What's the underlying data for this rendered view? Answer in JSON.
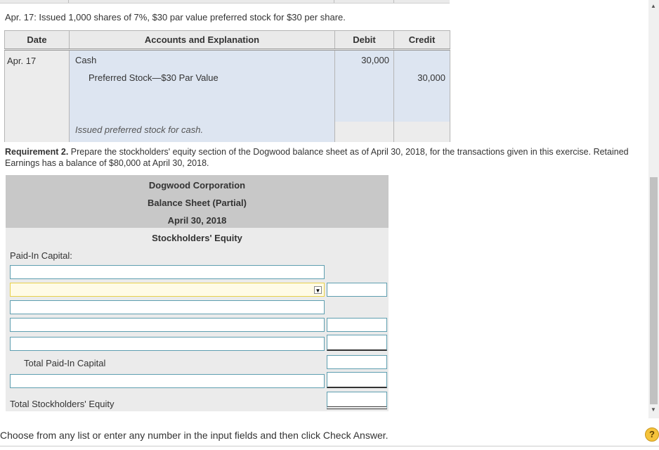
{
  "problem_text": "Apr. 17: Issued 1,000 shares of 7%, $30 par value preferred stock for $30 per share.",
  "journal": {
    "headers": {
      "date": "Date",
      "accounts": "Accounts and Explanation",
      "debit": "Debit",
      "credit": "Credit"
    },
    "date": "Apr. 17",
    "debit_account": "Cash",
    "debit_amount": "30,000",
    "credit_account": "Preferred Stock—$30 Par Value",
    "credit_amount": "30,000",
    "explanation": "Issued preferred stock for cash."
  },
  "requirement": {
    "label": "Requirement 2.",
    "text": " Prepare the stockholders' equity section of the Dogwood balance sheet as of April 30, 2018, for the transactions given in this exercise. Retained Earnings has a balance of $80,000 at April 30, 2018."
  },
  "balance_sheet": {
    "company": "Dogwood Corporation",
    "statement": "Balance Sheet (Partial)",
    "date": "April 30, 2018",
    "section": "Stockholders' Equity",
    "paid_in_label": "Paid-In Capital:",
    "total_paid_in_label": "Total Paid-In Capital",
    "total_equity_label": "Total Stockholders' Equity"
  },
  "footer_text": "Choose from any list or enter any number in the input fields and then click Check Answer.",
  "help_label": "?",
  "dropdown_arrow": "▼",
  "scroll_up": "▲",
  "scroll_down": "▼",
  "colors": {
    "input_border": "#5e9eb0",
    "dropdown_border": "#e8d14a",
    "journal_blue": "#dde5f1",
    "header_gray": "#c8c8c8"
  }
}
